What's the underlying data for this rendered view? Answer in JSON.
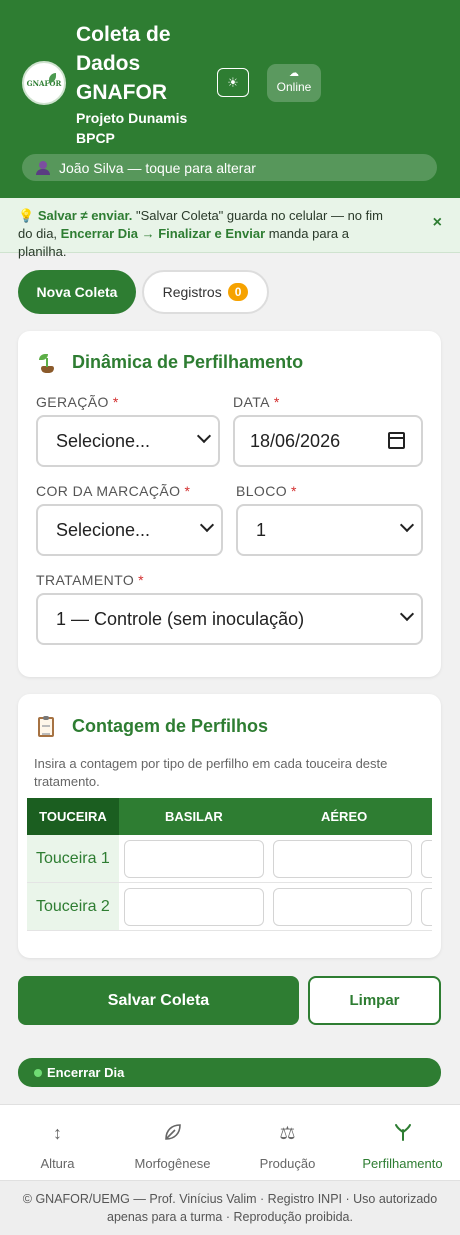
{
  "header": {
    "logo_text": "GNAFOR",
    "title": "Coleta de Dados GNAFOR",
    "subtitle": "Projeto Dunamis BPCP",
    "theme_icon": "sun-icon",
    "status_label": "Online",
    "status_icon": "cloud-icon",
    "user_label": "João Silva — toque para alterar"
  },
  "tip": {
    "strong1": "Salvar ≠ enviar.",
    "text1": " \"Salvar Coleta\" guarda no celular — no fim do dia, ",
    "strong2": "Encerrar Dia → Finalizar e Enviar",
    "text2": " manda para a planilha.",
    "close": "×"
  },
  "tabs": {
    "new_label": "Nova Coleta",
    "records_label": "Registros",
    "records_count": "0"
  },
  "form_card": {
    "title": "Dinâmica de Perfilhamento",
    "required_mark": "*",
    "geracao": {
      "label": "GERAÇÃO",
      "value": "Selecione..."
    },
    "data": {
      "label": "DATA",
      "value": "18/06/2026"
    },
    "cor": {
      "label": "COR DA MARCAÇÃO",
      "value": "Selecione..."
    },
    "bloco": {
      "label": "BLOCO",
      "value": "1"
    },
    "tratamento": {
      "label": "TRATAMENTO",
      "value": "1 — Controle (sem inoculação)"
    }
  },
  "count_card": {
    "title": "Contagem de Perfilhos",
    "description": "Insira a contagem por tipo de perfilho em cada touceira deste tratamento.",
    "columns": [
      "TOUCEIRA",
      "BASILAR",
      "AÉREO"
    ],
    "rows": [
      "Touceira 1",
      "Touceira 2"
    ]
  },
  "actions": {
    "save": "Salvar Coleta",
    "clear": "Limpar",
    "end_day": "Encerrar Dia"
  },
  "nav": {
    "items": [
      {
        "label": "Altura",
        "icon": "up-down-arrows-icon"
      },
      {
        "label": "Morfogênese",
        "icon": "leaf-icon"
      },
      {
        "label": "Produção",
        "icon": "scale-icon"
      },
      {
        "label": "Perfilhamento",
        "icon": "sprout-icon"
      }
    ],
    "active": "Perfilhamento"
  },
  "footer": "© GNAFOR/UEMG — Prof. Vinícius Valim · Registro INPI · Uso autorizado apenas para a turma · Reprodução proibida.",
  "colors": {
    "primary": "#2e7d32",
    "dark": "#1b5e20",
    "badge": "#f6a200",
    "required": "#d32f2f",
    "background": "#f1f1f1"
  }
}
